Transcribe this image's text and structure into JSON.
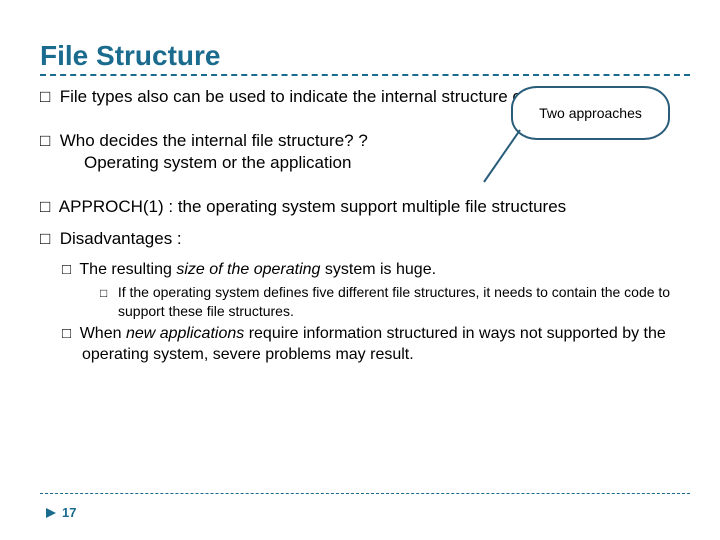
{
  "title": "File Structure",
  "callout": "Two approaches",
  "bullets": {
    "b1_lead": "File",
    "b1_rest": " types also can be used to indicate the internal structure of the file.",
    "b2_lead": "Who",
    "b2_rest": " decides the internal file structure? ?",
    "b2_sub": "Operating system  or   the application",
    "b3_lead": "APPROCH(1)",
    "b3_rest": " : the operating system support multiple file structures",
    "b4_lead": "Disadvantages",
    "b4_rest": " :",
    "b4a_pre": "The ",
    "b4a_mid1": "resulting ",
    "b4a_mid2": "size of the operating ",
    "b4a_mid3": "system is huge",
    "b4a_end": ".",
    "b4a_sub": "If the operating system defines five different file structures, it needs to contain the code to support these file structures.",
    "b4b_pre": "When ",
    "b4b_mid": "new applications ",
    "b4b_rest": "require information structured in ways not supported by the operating system, severe problems may result."
  },
  "page_number": "17"
}
